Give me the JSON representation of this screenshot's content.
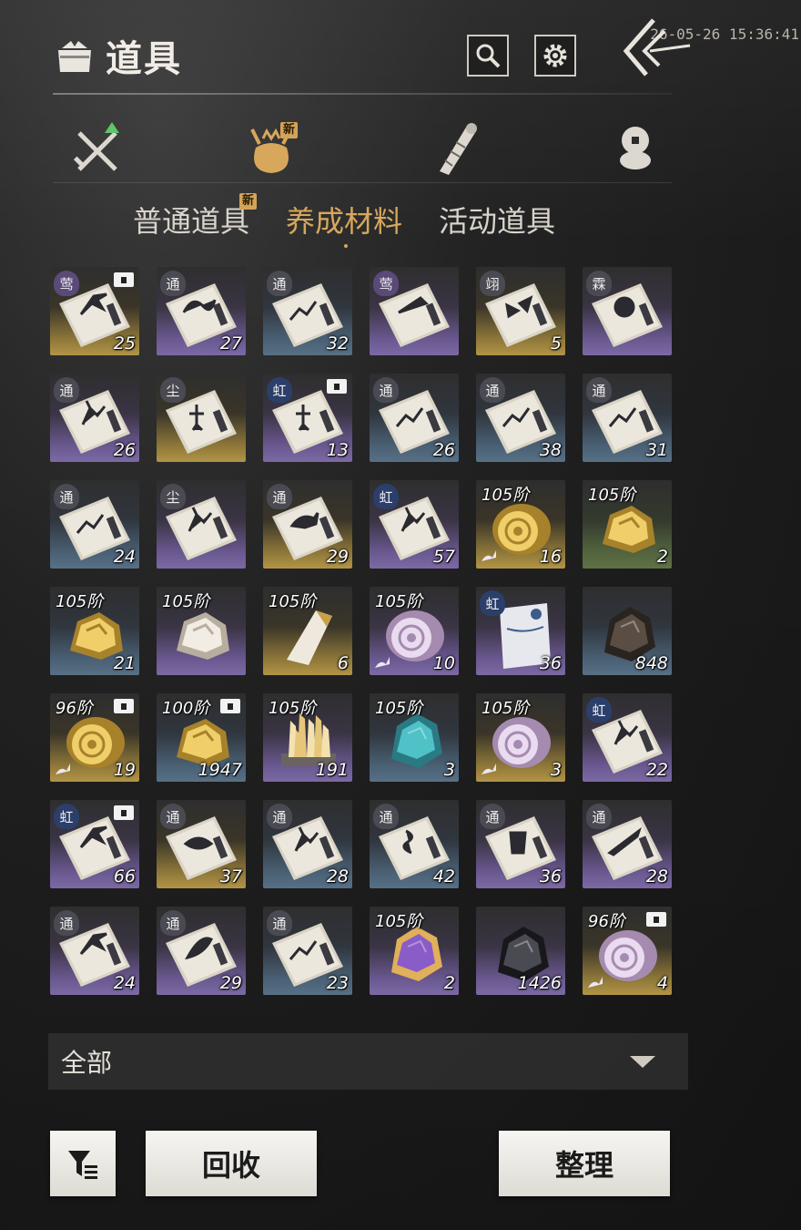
{
  "header": {
    "title": "道具",
    "timestamp": "26-05-26 15:36:41",
    "icons": [
      "bag-icon",
      "search-icon",
      "gear-icon",
      "back-arrow-icon"
    ]
  },
  "category_tabs": [
    {
      "icon": "swords-icon",
      "badge": ""
    },
    {
      "icon": "pouch-icon",
      "badge": "新",
      "active": true
    },
    {
      "icon": "scroll-icon",
      "badge": ""
    },
    {
      "icon": "coins-icon",
      "badge": ""
    }
  ],
  "subtabs": [
    {
      "label": "普通道具",
      "badge": "新"
    },
    {
      "label": "养成材料",
      "badge": "",
      "active": true
    },
    {
      "label": "活动道具",
      "badge": ""
    }
  ],
  "items": [
    {
      "kind": "book",
      "quality": "gold",
      "grade": "莺",
      "count": "25",
      "bound": true,
      "motif": "bird"
    },
    {
      "kind": "book",
      "quality": "purple",
      "grade": "通",
      "count": "27",
      "motif": "dragon"
    },
    {
      "kind": "book",
      "quality": "blue",
      "grade": "通",
      "count": "32",
      "motif": "stars"
    },
    {
      "kind": "book",
      "quality": "purple",
      "grade": "莺",
      "count": "",
      "motif": "hat"
    },
    {
      "kind": "book",
      "quality": "gold",
      "grade": "翊",
      "count": "5",
      "motif": "butterfly"
    },
    {
      "kind": "book",
      "quality": "purple",
      "grade": "霖",
      "count": "",
      "motif": "taiji"
    },
    {
      "kind": "book",
      "quality": "purple",
      "grade": "通",
      "count": "26",
      "motif": "fighter"
    },
    {
      "kind": "book",
      "quality": "gold",
      "grade": "尘",
      "count": "",
      "motif": "figure"
    },
    {
      "kind": "book",
      "quality": "purple",
      "grade": "虹",
      "count": "13",
      "bound": true,
      "motif": "figure"
    },
    {
      "kind": "book",
      "quality": "blue",
      "grade": "通",
      "count": "26",
      "motif": "stars"
    },
    {
      "kind": "book",
      "quality": "blue",
      "grade": "通",
      "count": "38",
      "motif": "stars"
    },
    {
      "kind": "book",
      "quality": "blue",
      "grade": "通",
      "count": "31",
      "motif": "stars"
    },
    {
      "kind": "book",
      "quality": "blue",
      "grade": "通",
      "count": "24",
      "motif": "stars"
    },
    {
      "kind": "book",
      "quality": "purple",
      "grade": "尘",
      "count": "",
      "motif": "fighter"
    },
    {
      "kind": "book",
      "quality": "gold",
      "grade": "通",
      "count": "29",
      "motif": "horse"
    },
    {
      "kind": "book",
      "quality": "purple",
      "grade": "虹",
      "count": "57",
      "motif": "fighter"
    },
    {
      "kind": "shell",
      "quality": "gold",
      "tier": "105阶",
      "count": "16",
      "upgrade": true,
      "color": "gold"
    },
    {
      "kind": "nugget",
      "quality": "green",
      "tier": "105阶",
      "count": "2",
      "color": "gold"
    },
    {
      "kind": "nugget",
      "quality": "blue",
      "tier": "105阶",
      "count": "21",
      "color": "gold"
    },
    {
      "kind": "nugget",
      "quality": "purple",
      "tier": "105阶",
      "count": "",
      "color": "white"
    },
    {
      "kind": "crystal",
      "quality": "gold",
      "tier": "105阶",
      "count": "6",
      "color": "white"
    },
    {
      "kind": "shell",
      "quality": "purple",
      "tier": "105阶",
      "count": "10",
      "upgrade": true,
      "color": "pink"
    },
    {
      "kind": "letter",
      "quality": "purple",
      "grade": "虹",
      "count": "36"
    },
    {
      "kind": "ore",
      "quality": "blue",
      "tier": "",
      "count": "848",
      "color": "dark"
    },
    {
      "kind": "shell",
      "quality": "gold",
      "tier": "96阶",
      "count": "19",
      "bound": true,
      "upgrade": true,
      "color": "gold"
    },
    {
      "kind": "nugget",
      "quality": "blue",
      "tier": "100阶",
      "count": "1947",
      "bound": true,
      "color": "gold"
    },
    {
      "kind": "quartz",
      "quality": "purple",
      "tier": "105阶",
      "count": "191"
    },
    {
      "kind": "ore",
      "quality": "blue",
      "tier": "105阶",
      "count": "3",
      "color": "teal"
    },
    {
      "kind": "shell",
      "quality": "gold",
      "tier": "105阶",
      "count": "3",
      "upgrade": true,
      "color": "pink"
    },
    {
      "kind": "book",
      "quality": "purple",
      "grade": "虹",
      "count": "22",
      "motif": "fighter"
    },
    {
      "kind": "book",
      "quality": "purple",
      "grade": "虹",
      "count": "66",
      "bound": true,
      "motif": "bird"
    },
    {
      "kind": "book",
      "quality": "gold",
      "grade": "通",
      "count": "37",
      "motif": "fish"
    },
    {
      "kind": "book",
      "quality": "blue",
      "grade": "通",
      "count": "28",
      "motif": "fighter"
    },
    {
      "kind": "book",
      "quality": "blue",
      "grade": "通",
      "count": "42",
      "motif": "snake"
    },
    {
      "kind": "book",
      "quality": "purple",
      "grade": "通",
      "count": "36",
      "motif": "armor"
    },
    {
      "kind": "book",
      "quality": "purple",
      "grade": "通",
      "count": "28",
      "motif": "blade"
    },
    {
      "kind": "book",
      "quality": "purple",
      "grade": "通",
      "count": "24",
      "motif": "bird"
    },
    {
      "kind": "book",
      "quality": "purple",
      "grade": "通",
      "count": "29",
      "motif": "leaf"
    },
    {
      "kind": "book",
      "quality": "blue",
      "grade": "通",
      "count": "23",
      "motif": "stars"
    },
    {
      "kind": "ore",
      "quality": "purple",
      "tier": "105阶",
      "count": "2",
      "color": "amethyst"
    },
    {
      "kind": "ore",
      "quality": "purple",
      "tier": "",
      "count": "1426",
      "color": "black"
    },
    {
      "kind": "shell",
      "quality": "gold",
      "tier": "96阶",
      "count": "4",
      "bound": true,
      "upgrade": true,
      "color": "pink"
    }
  ],
  "filter": {
    "label": "全部",
    "icon": "chevron-down-icon"
  },
  "buttons": {
    "filter_icon": "filter-icon",
    "recycle": "回收",
    "sort": "整理"
  },
  "colors": {
    "accent": "#d7a75c",
    "badge": "#d3a457",
    "quality_gold": "#b29446",
    "quality_purple": "#7c69a4",
    "quality_blue": "#577086",
    "quality_green": "#5f7245"
  }
}
